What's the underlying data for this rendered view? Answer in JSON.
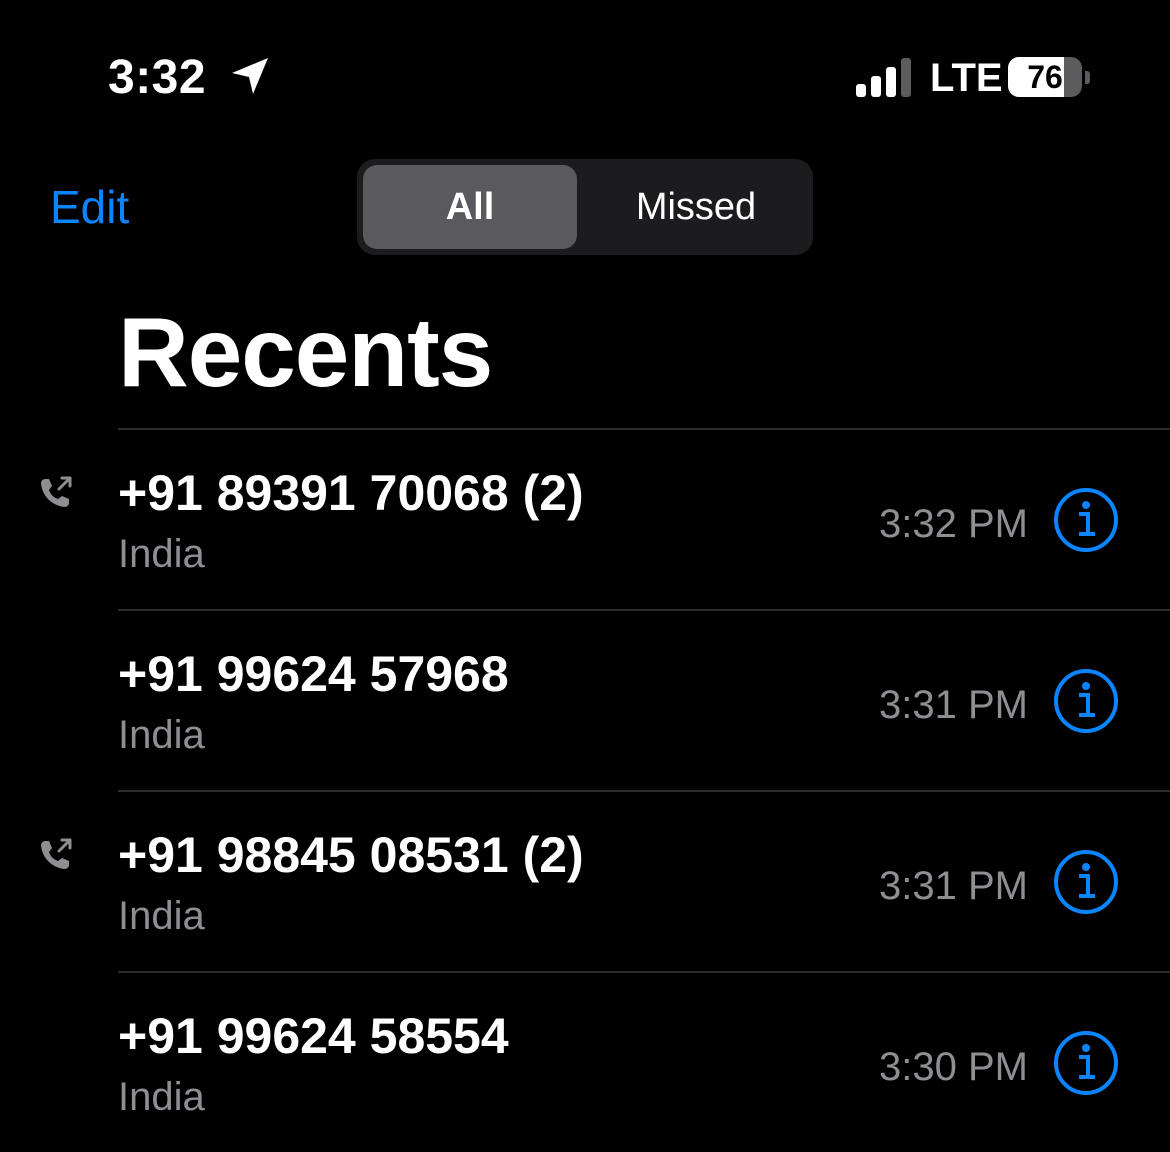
{
  "status_bar": {
    "time": "3:32",
    "location_icon": "location-arrow-icon",
    "signal_icon": "cellular-signal-icon",
    "signal_bars_active": 3,
    "signal_bars_total": 4,
    "network": "LTE",
    "battery_level": "76",
    "battery_fraction": 0.76
  },
  "nav": {
    "edit_label": "Edit",
    "segments": [
      {
        "label": "All",
        "selected": true
      },
      {
        "label": "Missed",
        "selected": false
      }
    ]
  },
  "title": "Recents",
  "colors": {
    "accent": "#0a84ff",
    "background": "#000000",
    "secondary_text": "#8e8e93",
    "divider": "#2c2c2e"
  },
  "calls": [
    {
      "number": "+91 89391 70068 (2)",
      "location": "India",
      "time": "3:32 PM",
      "outgoing": true,
      "icon": "outgoing-call-icon",
      "info_icon": "info-icon"
    },
    {
      "number": "+91 99624 57968",
      "location": "India",
      "time": "3:31 PM",
      "outgoing": false,
      "info_icon": "info-icon"
    },
    {
      "number": "+91 98845 08531 (2)",
      "location": "India",
      "time": "3:31 PM",
      "outgoing": true,
      "icon": "outgoing-call-icon",
      "info_icon": "info-icon"
    },
    {
      "number": "+91 99624 58554",
      "location": "India",
      "time": "3:30 PM",
      "outgoing": false,
      "info_icon": "info-icon"
    }
  ]
}
